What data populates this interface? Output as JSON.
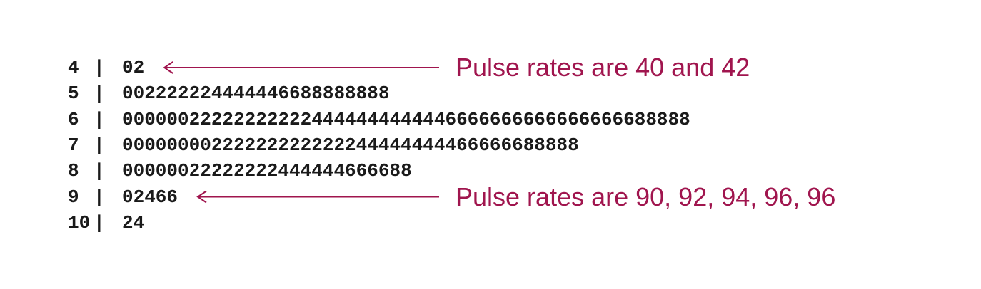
{
  "chart_data": {
    "type": "stem-and-leaf",
    "title": "",
    "rows": [
      {
        "stem": "4",
        "leaves": "02"
      },
      {
        "stem": "5",
        "leaves": "002222224444446688888888"
      },
      {
        "stem": "6",
        "leaves": "000000222222222224444444444446666666666666666688888"
      },
      {
        "stem": "7",
        "leaves": "00000000222222222222244444444466666688888"
      },
      {
        "stem": "8",
        "leaves": "00000022222222444444666688"
      },
      {
        "stem": "9",
        "leaves": "02466"
      },
      {
        "stem": "10",
        "leaves": "24"
      }
    ],
    "annotations": [
      {
        "text": "Pulse rates are 40 and 42",
        "row": 0
      },
      {
        "text": "Pulse rates are 90, 92, 94, 96, 96",
        "row": 5
      }
    ],
    "colors": {
      "text": "#1a1a1a",
      "annotation": "#a0154e"
    }
  }
}
